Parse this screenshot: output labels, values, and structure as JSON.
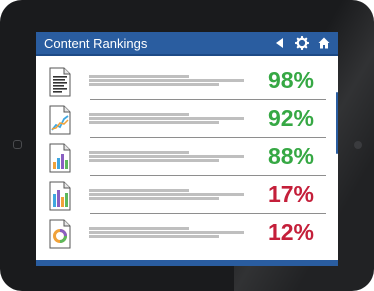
{
  "header": {
    "title": "Content Rankings",
    "back_icon": "back-triangle-icon",
    "settings_icon": "gear-icon",
    "home_icon": "home-icon"
  },
  "rows": [
    {
      "icon": "text-document-icon",
      "value": "98%",
      "status": "good"
    },
    {
      "icon": "line-chart-document-icon",
      "value": "92%",
      "status": "good"
    },
    {
      "icon": "bar-chart-document-icon",
      "value": "88%",
      "status": "good"
    },
    {
      "icon": "bar-chart-document-icon",
      "value": "17%",
      "status": "bad"
    },
    {
      "icon": "pie-chart-document-icon",
      "value": "12%",
      "status": "bad"
    }
  ],
  "colors": {
    "accent": "#2a5da0",
    "good": "#36a844",
    "bad": "#c41f3a"
  }
}
